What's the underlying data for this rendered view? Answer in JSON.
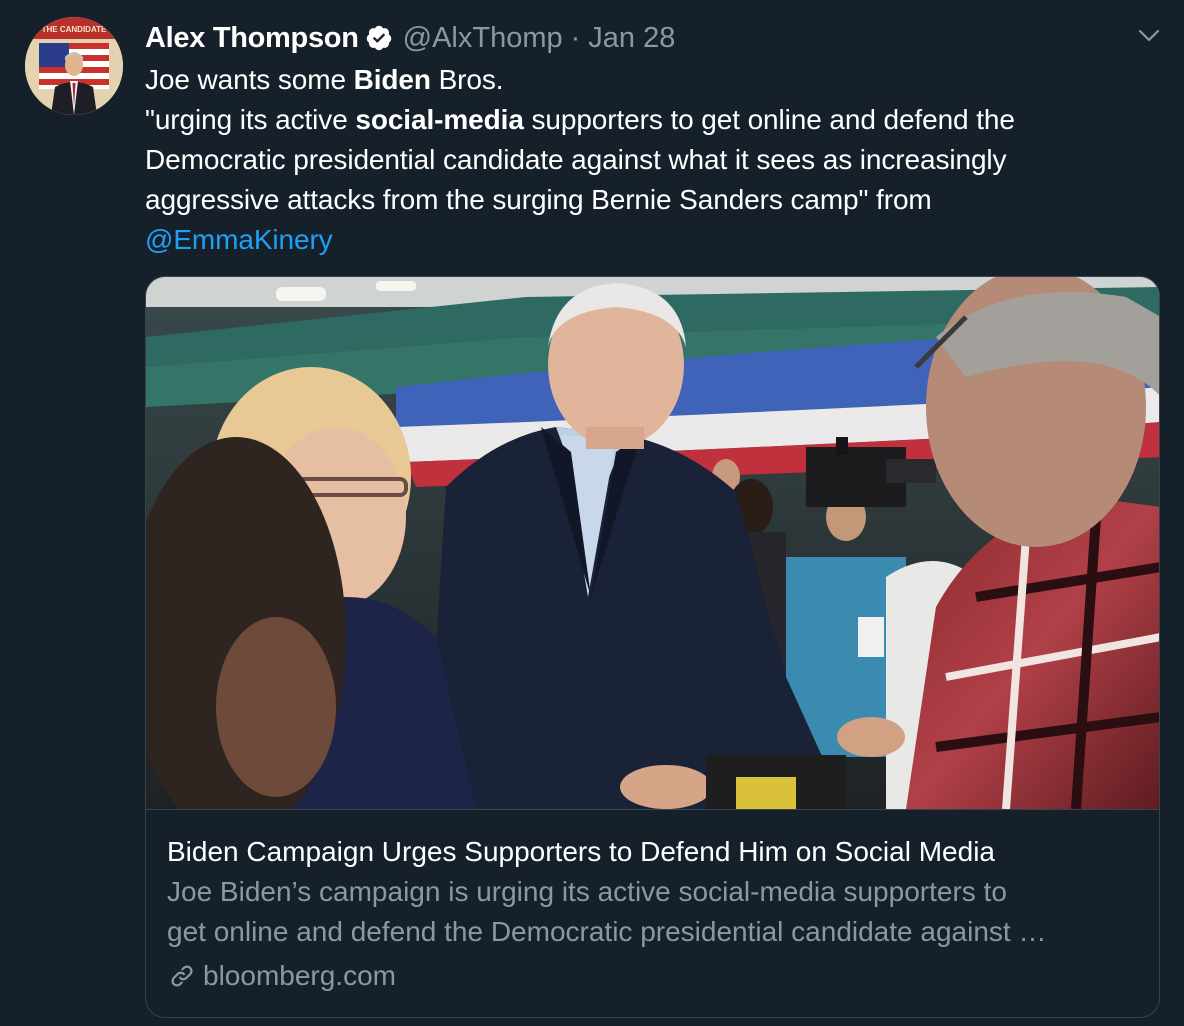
{
  "author": {
    "display_name": "Alex Thompson",
    "handle": "@AlxThomp",
    "separator": "·",
    "date": "Jan 28",
    "verified_icon": "verified-badge-icon",
    "avatar_banner_text": "THE CANDIDATE"
  },
  "tweet": {
    "line1_pre": "Joe wants some ",
    "line1_bold": "Biden",
    "line1_post": " Bros.",
    "line2_pre": "\"urging its active ",
    "line2_bold": "social-media",
    "line2_post": " supporters to get online and defend the",
    "line3": "Democratic presidential candidate against what it sees as increasingly",
    "line4": "aggressive attacks from the surging Bernie Sanders camp\" from",
    "mention": "@EmmaKinery"
  },
  "card": {
    "title": "Biden Campaign Urges Supporters to Defend Him on Social Media",
    "desc_line1": "Joe Biden’s campaign is urging its active social-media supporters to",
    "desc_line2": "get online and defend the Democratic presidential candidate against …",
    "domain": "bloomberg.com",
    "domain_icon": "link-icon"
  },
  "colors": {
    "background": "#15202b",
    "text": "#ffffff",
    "secondary": "#8899a6",
    "link": "#1da1f2",
    "border": "#38444d"
  }
}
